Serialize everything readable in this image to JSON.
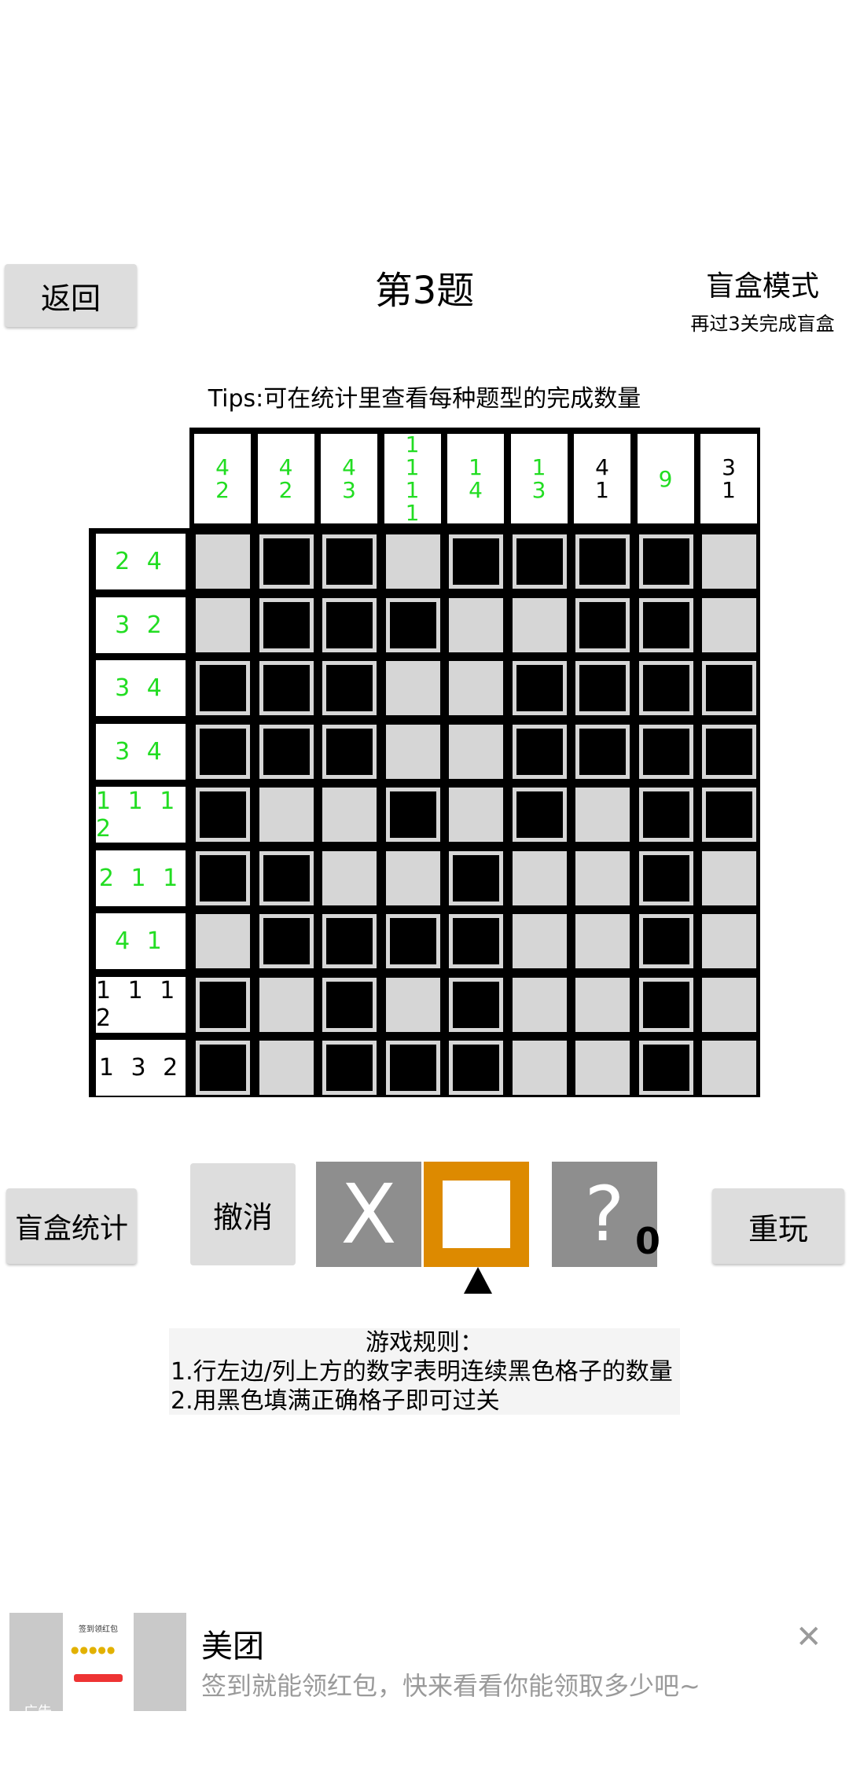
{
  "header": {
    "back_label": "返回",
    "title": "第3题",
    "mode_label": "盲盒模式",
    "mode_sub": "再过3关完成盲盒"
  },
  "tips": "Tips:可在统计里查看每种题型的完成数量",
  "puzzle": {
    "col_clues": [
      {
        "text": "4\n2",
        "color": "#22dd22"
      },
      {
        "text": "4\n2",
        "color": "#22dd22"
      },
      {
        "text": "4\n3",
        "color": "#22dd22"
      },
      {
        "text": "1\n1\n1\n1",
        "color": "#22dd22"
      },
      {
        "text": "1\n4",
        "color": "#22dd22"
      },
      {
        "text": "1\n3",
        "color": "#22dd22"
      },
      {
        "text": "4\n1",
        "color": "#000000"
      },
      {
        "text": "9",
        "color": "#22dd22"
      },
      {
        "text": "3\n1",
        "color": "#000000"
      }
    ],
    "row_clues": [
      {
        "text": "2 4",
        "color": "#22dd22"
      },
      {
        "text": "3 2",
        "color": "#22dd22"
      },
      {
        "text": "3 4",
        "color": "#22dd22"
      },
      {
        "text": "3 4",
        "color": "#22dd22"
      },
      {
        "text": "1 1 1 2",
        "color": "#22dd22"
      },
      {
        "text": "2 1 1",
        "color": "#22dd22"
      },
      {
        "text": "4 1",
        "color": "#22dd22"
      },
      {
        "text": "1 1 1 2",
        "color": "#000000"
      },
      {
        "text": "1 3 2",
        "color": "#000000"
      }
    ],
    "grid": [
      [
        0,
        1,
        1,
        0,
        1,
        1,
        1,
        1,
        0
      ],
      [
        0,
        1,
        1,
        1,
        0,
        0,
        1,
        1,
        0
      ],
      [
        1,
        1,
        1,
        0,
        0,
        1,
        1,
        1,
        1
      ],
      [
        1,
        1,
        1,
        0,
        0,
        1,
        1,
        1,
        1
      ],
      [
        1,
        0,
        0,
        1,
        0,
        1,
        0,
        1,
        1
      ],
      [
        1,
        1,
        0,
        0,
        1,
        0,
        0,
        1,
        0
      ],
      [
        0,
        1,
        1,
        1,
        1,
        0,
        0,
        1,
        0
      ],
      [
        1,
        0,
        1,
        0,
        1,
        0,
        0,
        1,
        0
      ],
      [
        1,
        0,
        1,
        1,
        1,
        0,
        0,
        1,
        0
      ]
    ]
  },
  "controls": {
    "stats_label": "盲盒统计",
    "undo_label": "撤消",
    "x_tool": "X",
    "hint_tool": "?",
    "hint_count": "0",
    "replay_label": "重玩",
    "selected_tool": "fill",
    "tool_x_color": "#8e8e8e",
    "tool_fill_color": "#dd8a00"
  },
  "rules": {
    "title": "游戏规则：",
    "line1": "1.行左边/列上方的数字表明连续黑色格子的数量",
    "line2": "2.用黑色填满正确格子即可过关"
  },
  "ad": {
    "brand": "美团",
    "text": "签到就能领红包，快来看看你能领取多少吧~",
    "label": "广告",
    "card_title": "签到领红包",
    "close_icon": "close-icon"
  }
}
